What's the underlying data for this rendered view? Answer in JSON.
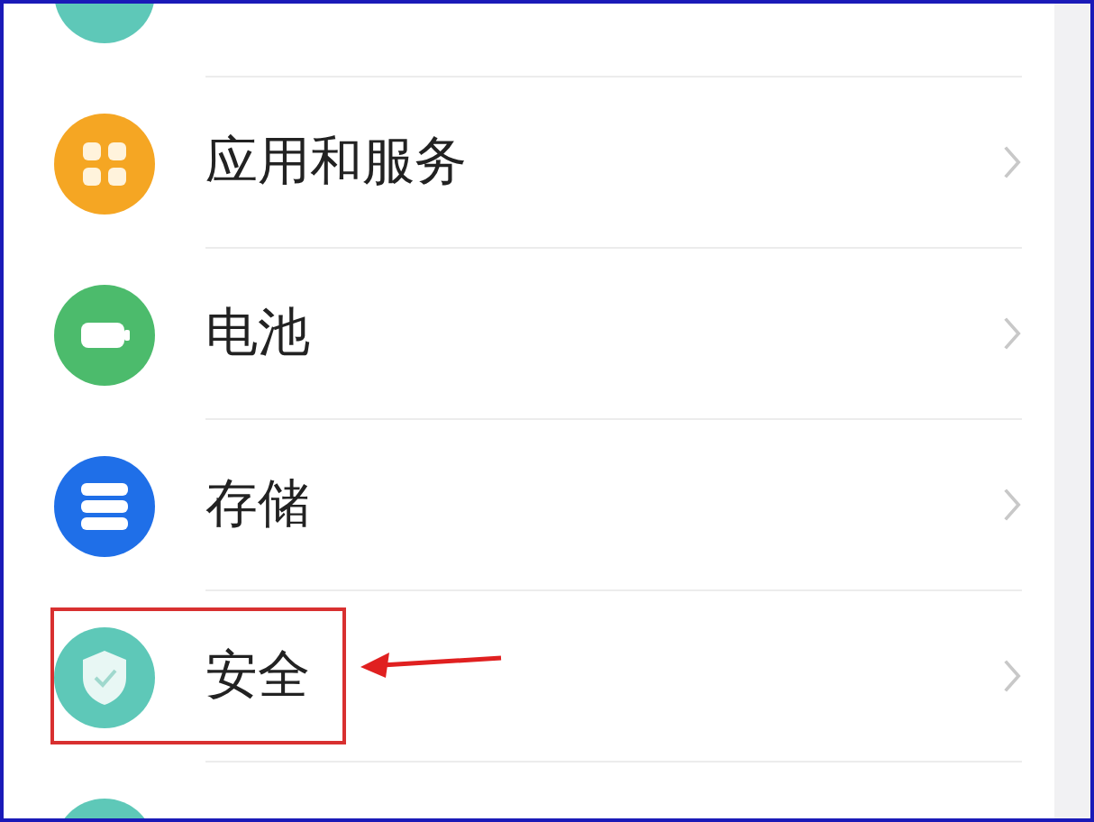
{
  "settings": [
    {
      "kind": "partial",
      "color": "#5ec8b8",
      "highlighted": false
    },
    {
      "kind": "apps",
      "label": "应用和服务",
      "color": "#f5a623",
      "highlighted": false
    },
    {
      "kind": "battery",
      "label": "电池",
      "color": "#4cbb6c",
      "highlighted": false
    },
    {
      "kind": "storage",
      "label": "存储",
      "color": "#1f6fe8",
      "highlighted": false
    },
    {
      "kind": "security",
      "label": "安全",
      "color": "#5ec8b8",
      "highlighted": true
    },
    {
      "kind": "partial",
      "color": "#5ec8b8",
      "highlighted": false
    }
  ]
}
